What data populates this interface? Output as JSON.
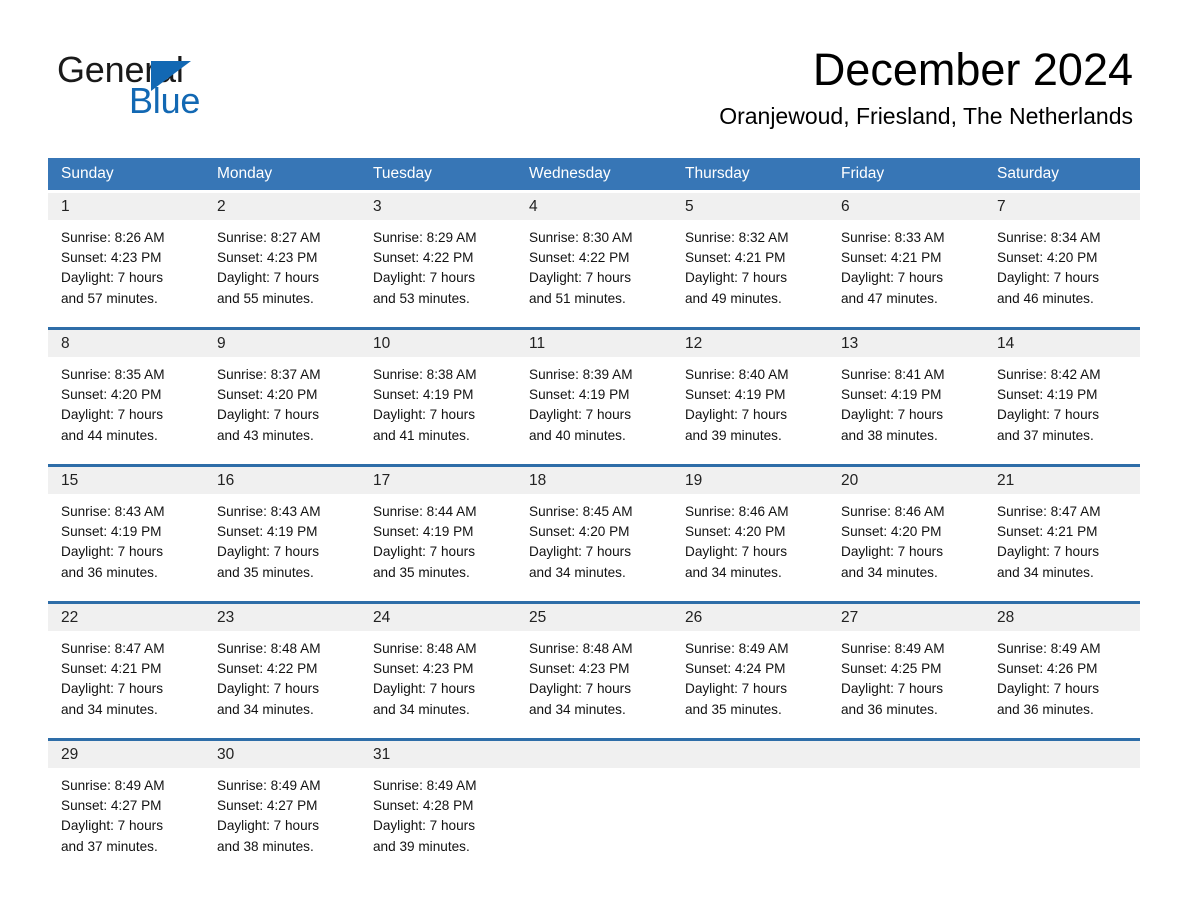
{
  "brand": {
    "name_part1": "General",
    "name_part2": "Blue",
    "accent_color": "#1268b3"
  },
  "header": {
    "month_title": "December 2024",
    "location": "Oranjewoud, Friesland, The Netherlands"
  },
  "theme": {
    "header_row_bg": "#3776b6",
    "week_divider": "#2e6da8",
    "daynum_bg": "#f0f0f0"
  },
  "calendar": {
    "weekday_headers": [
      "Sunday",
      "Monday",
      "Tuesday",
      "Wednesday",
      "Thursday",
      "Friday",
      "Saturday"
    ],
    "weeks": [
      [
        {
          "day": "1",
          "sunrise": "Sunrise: 8:26 AM",
          "sunset": "Sunset: 4:23 PM",
          "daylight_1": "Daylight: 7 hours",
          "daylight_2": "and 57 minutes."
        },
        {
          "day": "2",
          "sunrise": "Sunrise: 8:27 AM",
          "sunset": "Sunset: 4:23 PM",
          "daylight_1": "Daylight: 7 hours",
          "daylight_2": "and 55 minutes."
        },
        {
          "day": "3",
          "sunrise": "Sunrise: 8:29 AM",
          "sunset": "Sunset: 4:22 PM",
          "daylight_1": "Daylight: 7 hours",
          "daylight_2": "and 53 minutes."
        },
        {
          "day": "4",
          "sunrise": "Sunrise: 8:30 AM",
          "sunset": "Sunset: 4:22 PM",
          "daylight_1": "Daylight: 7 hours",
          "daylight_2": "and 51 minutes."
        },
        {
          "day": "5",
          "sunrise": "Sunrise: 8:32 AM",
          "sunset": "Sunset: 4:21 PM",
          "daylight_1": "Daylight: 7 hours",
          "daylight_2": "and 49 minutes."
        },
        {
          "day": "6",
          "sunrise": "Sunrise: 8:33 AM",
          "sunset": "Sunset: 4:21 PM",
          "daylight_1": "Daylight: 7 hours",
          "daylight_2": "and 47 minutes."
        },
        {
          "day": "7",
          "sunrise": "Sunrise: 8:34 AM",
          "sunset": "Sunset: 4:20 PM",
          "daylight_1": "Daylight: 7 hours",
          "daylight_2": "and 46 minutes."
        }
      ],
      [
        {
          "day": "8",
          "sunrise": "Sunrise: 8:35 AM",
          "sunset": "Sunset: 4:20 PM",
          "daylight_1": "Daylight: 7 hours",
          "daylight_2": "and 44 minutes."
        },
        {
          "day": "9",
          "sunrise": "Sunrise: 8:37 AM",
          "sunset": "Sunset: 4:20 PM",
          "daylight_1": "Daylight: 7 hours",
          "daylight_2": "and 43 minutes."
        },
        {
          "day": "10",
          "sunrise": "Sunrise: 8:38 AM",
          "sunset": "Sunset: 4:19 PM",
          "daylight_1": "Daylight: 7 hours",
          "daylight_2": "and 41 minutes."
        },
        {
          "day": "11",
          "sunrise": "Sunrise: 8:39 AM",
          "sunset": "Sunset: 4:19 PM",
          "daylight_1": "Daylight: 7 hours",
          "daylight_2": "and 40 minutes."
        },
        {
          "day": "12",
          "sunrise": "Sunrise: 8:40 AM",
          "sunset": "Sunset: 4:19 PM",
          "daylight_1": "Daylight: 7 hours",
          "daylight_2": "and 39 minutes."
        },
        {
          "day": "13",
          "sunrise": "Sunrise: 8:41 AM",
          "sunset": "Sunset: 4:19 PM",
          "daylight_1": "Daylight: 7 hours",
          "daylight_2": "and 38 minutes."
        },
        {
          "day": "14",
          "sunrise": "Sunrise: 8:42 AM",
          "sunset": "Sunset: 4:19 PM",
          "daylight_1": "Daylight: 7 hours",
          "daylight_2": "and 37 minutes."
        }
      ],
      [
        {
          "day": "15",
          "sunrise": "Sunrise: 8:43 AM",
          "sunset": "Sunset: 4:19 PM",
          "daylight_1": "Daylight: 7 hours",
          "daylight_2": "and 36 minutes."
        },
        {
          "day": "16",
          "sunrise": "Sunrise: 8:43 AM",
          "sunset": "Sunset: 4:19 PM",
          "daylight_1": "Daylight: 7 hours",
          "daylight_2": "and 35 minutes."
        },
        {
          "day": "17",
          "sunrise": "Sunrise: 8:44 AM",
          "sunset": "Sunset: 4:19 PM",
          "daylight_1": "Daylight: 7 hours",
          "daylight_2": "and 35 minutes."
        },
        {
          "day": "18",
          "sunrise": "Sunrise: 8:45 AM",
          "sunset": "Sunset: 4:20 PM",
          "daylight_1": "Daylight: 7 hours",
          "daylight_2": "and 34 minutes."
        },
        {
          "day": "19",
          "sunrise": "Sunrise: 8:46 AM",
          "sunset": "Sunset: 4:20 PM",
          "daylight_1": "Daylight: 7 hours",
          "daylight_2": "and 34 minutes."
        },
        {
          "day": "20",
          "sunrise": "Sunrise: 8:46 AM",
          "sunset": "Sunset: 4:20 PM",
          "daylight_1": "Daylight: 7 hours",
          "daylight_2": "and 34 minutes."
        },
        {
          "day": "21",
          "sunrise": "Sunrise: 8:47 AM",
          "sunset": "Sunset: 4:21 PM",
          "daylight_1": "Daylight: 7 hours",
          "daylight_2": "and 34 minutes."
        }
      ],
      [
        {
          "day": "22",
          "sunrise": "Sunrise: 8:47 AM",
          "sunset": "Sunset: 4:21 PM",
          "daylight_1": "Daylight: 7 hours",
          "daylight_2": "and 34 minutes."
        },
        {
          "day": "23",
          "sunrise": "Sunrise: 8:48 AM",
          "sunset": "Sunset: 4:22 PM",
          "daylight_1": "Daylight: 7 hours",
          "daylight_2": "and 34 minutes."
        },
        {
          "day": "24",
          "sunrise": "Sunrise: 8:48 AM",
          "sunset": "Sunset: 4:23 PM",
          "daylight_1": "Daylight: 7 hours",
          "daylight_2": "and 34 minutes."
        },
        {
          "day": "25",
          "sunrise": "Sunrise: 8:48 AM",
          "sunset": "Sunset: 4:23 PM",
          "daylight_1": "Daylight: 7 hours",
          "daylight_2": "and 34 minutes."
        },
        {
          "day": "26",
          "sunrise": "Sunrise: 8:49 AM",
          "sunset": "Sunset: 4:24 PM",
          "daylight_1": "Daylight: 7 hours",
          "daylight_2": "and 35 minutes."
        },
        {
          "day": "27",
          "sunrise": "Sunrise: 8:49 AM",
          "sunset": "Sunset: 4:25 PM",
          "daylight_1": "Daylight: 7 hours",
          "daylight_2": "and 36 minutes."
        },
        {
          "day": "28",
          "sunrise": "Sunrise: 8:49 AM",
          "sunset": "Sunset: 4:26 PM",
          "daylight_1": "Daylight: 7 hours",
          "daylight_2": "and 36 minutes."
        }
      ],
      [
        {
          "day": "29",
          "sunrise": "Sunrise: 8:49 AM",
          "sunset": "Sunset: 4:27 PM",
          "daylight_1": "Daylight: 7 hours",
          "daylight_2": "and 37 minutes."
        },
        {
          "day": "30",
          "sunrise": "Sunrise: 8:49 AM",
          "sunset": "Sunset: 4:27 PM",
          "daylight_1": "Daylight: 7 hours",
          "daylight_2": "and 38 minutes."
        },
        {
          "day": "31",
          "sunrise": "Sunrise: 8:49 AM",
          "sunset": "Sunset: 4:28 PM",
          "daylight_1": "Daylight: 7 hours",
          "daylight_2": "and 39 minutes."
        },
        {
          "day": "",
          "sunrise": "",
          "sunset": "",
          "daylight_1": "",
          "daylight_2": ""
        },
        {
          "day": "",
          "sunrise": "",
          "sunset": "",
          "daylight_1": "",
          "daylight_2": ""
        },
        {
          "day": "",
          "sunrise": "",
          "sunset": "",
          "daylight_1": "",
          "daylight_2": ""
        },
        {
          "day": "",
          "sunrise": "",
          "sunset": "",
          "daylight_1": "",
          "daylight_2": ""
        }
      ]
    ]
  }
}
